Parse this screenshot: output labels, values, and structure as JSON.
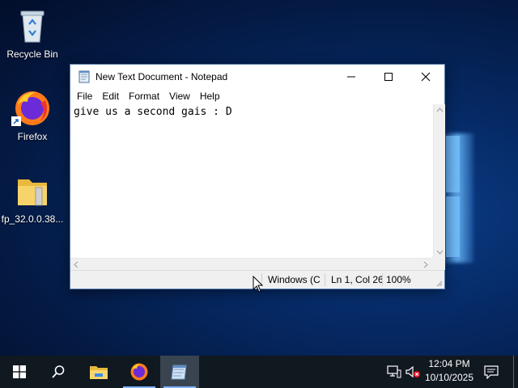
{
  "desktop": {
    "icons": [
      {
        "label": "Recycle Bin"
      },
      {
        "label": "Firefox"
      },
      {
        "label": "fp_32.0.0.38..."
      }
    ]
  },
  "notepad": {
    "title": "New Text Document - Notepad",
    "menu": [
      "File",
      "Edit",
      "Format",
      "View",
      "Help"
    ],
    "content": "give us a second gais : D",
    "status": {
      "encoding": "Windows (C",
      "position": "Ln 1, Col 26",
      "zoom": "100%"
    }
  },
  "taskbar": {
    "apps": [
      "start-icon",
      "search-icon",
      "file-explorer-icon",
      "firefox-icon",
      "notepad-icon"
    ],
    "time": "12:04 PM",
    "date": "10/10/2025"
  }
}
